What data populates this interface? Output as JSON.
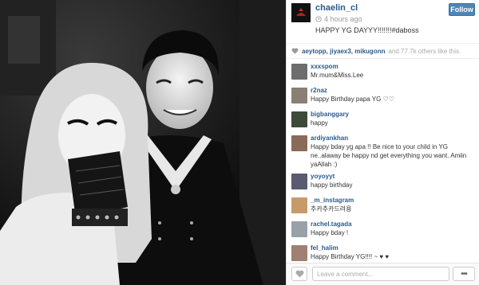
{
  "post": {
    "username": "chaelin_cl",
    "time": "4 hours ago",
    "follow_label": "Follow",
    "caption": "HAPPY YG DAYYY!!!!!!!#daboss",
    "likers": "aeytopp, jiyaex3, mikugonn",
    "likes_rest": "and 77.7k others like this."
  },
  "comments": [
    {
      "user": "xxxspom",
      "text": "Mr.mum&Miss.Lee",
      "avatar_color": "#6d6d6d"
    },
    {
      "user": "r2naz",
      "text": "Happy Birthday papa YG ♡♡",
      "avatar_color": "#8a7f74"
    },
    {
      "user": "bigbanggary",
      "text": "happy",
      "avatar_color": "#3d4a3a"
    },
    {
      "user": "ardiyankhan",
      "text": "Happy bday yg apa !! Be nice to your child in YG ne..alaway be happy nd get everything you want. Amiin yaAllah :)",
      "avatar_color": "#8a6a58"
    },
    {
      "user": "yoyoyyt",
      "text": "happy birthday",
      "avatar_color": "#5a5a70"
    },
    {
      "user": "_m_instagram",
      "text": "추카추카드려용",
      "avatar_color": "#c89a6a"
    },
    {
      "user": "rachel.tagada",
      "text": "Happy bday !",
      "avatar_color": "#9aa0a8"
    },
    {
      "user": "fel_halim",
      "text": "Happy Birthday YG!!!! ~ ♥ ♥",
      "avatar_color": "#a08070"
    }
  ],
  "footer": {
    "comment_placeholder": "Leave a comment...",
    "more_label": "•••"
  },
  "icons": {
    "clock": "clock-icon",
    "heart": "heart-icon",
    "like": "heart-icon",
    "more": "more-icon"
  }
}
